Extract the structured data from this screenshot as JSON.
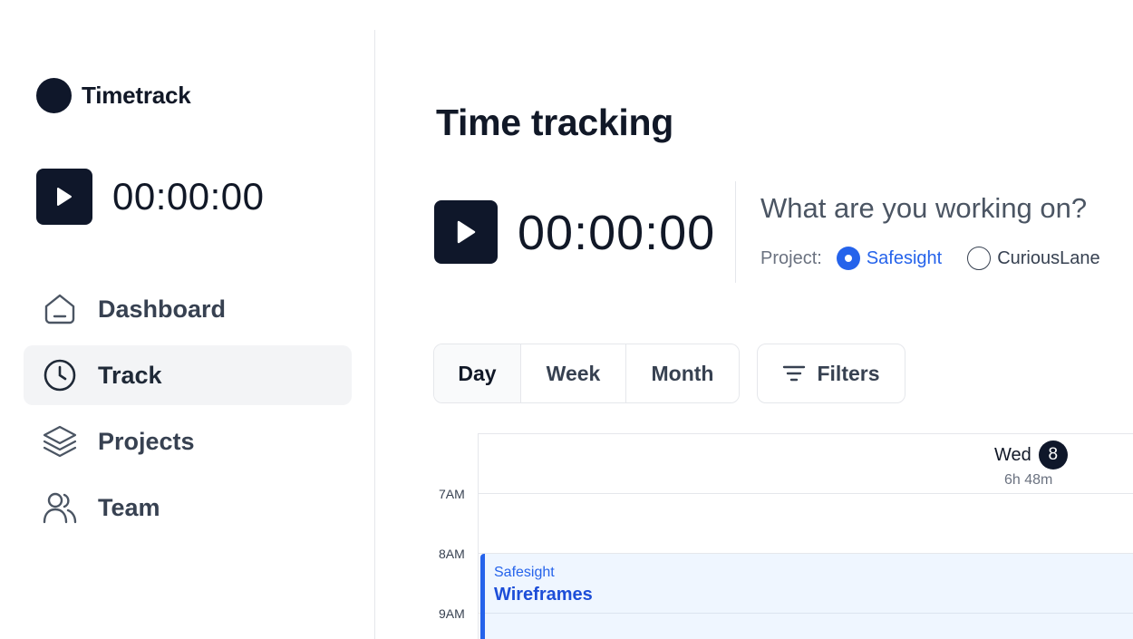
{
  "sidebar": {
    "brand": "Timetrack",
    "timer": "00:00:00",
    "nav": [
      {
        "label": "Dashboard",
        "icon": "home-icon",
        "active": false
      },
      {
        "label": "Track",
        "icon": "clock-icon",
        "active": true
      },
      {
        "label": "Projects",
        "icon": "layers-icon",
        "active": false
      },
      {
        "label": "Team",
        "icon": "users-icon",
        "active": false
      }
    ]
  },
  "main": {
    "title": "Time tracking",
    "timer": "00:00:00",
    "task_placeholder": "What are you working on?",
    "project_label": "Project:",
    "projects": [
      {
        "name": "Safesight",
        "selected": true
      },
      {
        "name": "CuriousLane",
        "selected": false
      }
    ],
    "views": [
      "Day",
      "Week",
      "Month"
    ],
    "active_view": "Day",
    "filters_label": "Filters"
  },
  "calendar": {
    "day_name": "Wed",
    "day_number": "8",
    "day_total": "6h 48m",
    "hours": [
      "7AM",
      "8AM",
      "9AM"
    ],
    "events": [
      {
        "project": "Safesight",
        "title": "Wireframes"
      }
    ]
  },
  "colors": {
    "accent": "#2563eb",
    "dark": "#0f172a",
    "event_bg": "#eff6ff"
  }
}
